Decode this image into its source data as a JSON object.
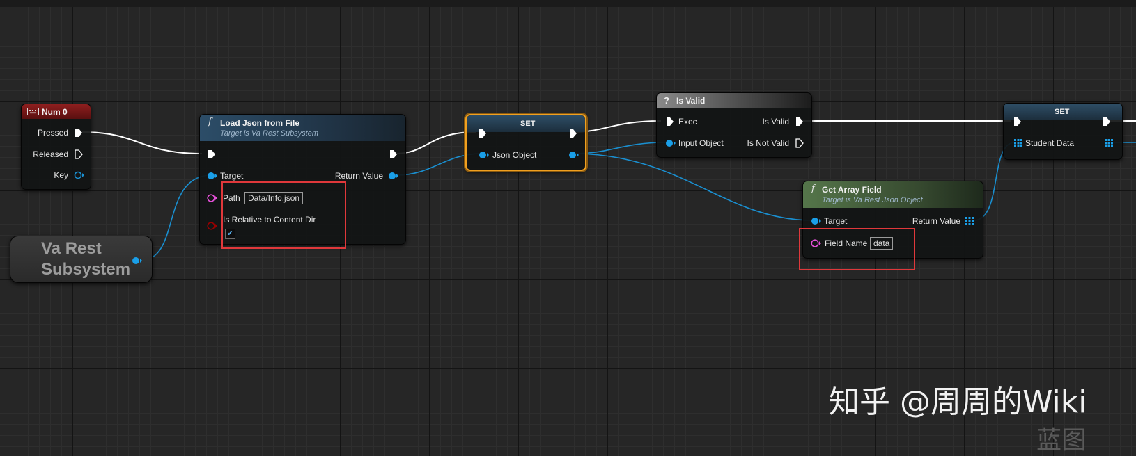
{
  "nodes": {
    "num0": {
      "title": "Num 0",
      "pins": {
        "pressed": "Pressed",
        "released": "Released",
        "key": "Key"
      }
    },
    "va_rest_subsystem": {
      "title_line1": "Va Rest",
      "title_line2": "Subsystem"
    },
    "load_json": {
      "title": "Load Json from File",
      "subtitle": "Target is Va Rest Subsystem",
      "pins": {
        "target": "Target",
        "path": "Path",
        "path_value": "Data/Info.json",
        "is_relative": "Is Relative to Content Dir",
        "is_relative_checked": true,
        "return_value": "Return Value"
      }
    },
    "set_json": {
      "title": "SET",
      "pins": {
        "json_object": "Json Object"
      }
    },
    "is_valid": {
      "title": "Is Valid",
      "pins": {
        "exec": "Exec",
        "input_object": "Input Object",
        "is_valid": "Is Valid",
        "is_not_valid": "Is Not Valid"
      }
    },
    "get_array_field": {
      "title": "Get Array Field",
      "subtitle": "Target is Va Rest Json Object",
      "pins": {
        "target": "Target",
        "return_value": "Return Value",
        "field_name": "Field Name",
        "field_name_value": "data"
      }
    },
    "set_student": {
      "title": "SET",
      "pins": {
        "student_data": "Student Data"
      }
    }
  },
  "watermark": {
    "main": "知乎 @周周的Wiki",
    "partial": "蓝图"
  },
  "colors": {
    "exec": "#ffffff",
    "object_pin": "#00a8f0",
    "string_pin": "#e24fd6",
    "bool_pin": "#960000",
    "event_header": "#7a1818",
    "function_header": "#2a4a62",
    "pure_header": "#4c6a3e",
    "selection_outline": "#f0a020",
    "highlight_box": "#e0383b"
  }
}
